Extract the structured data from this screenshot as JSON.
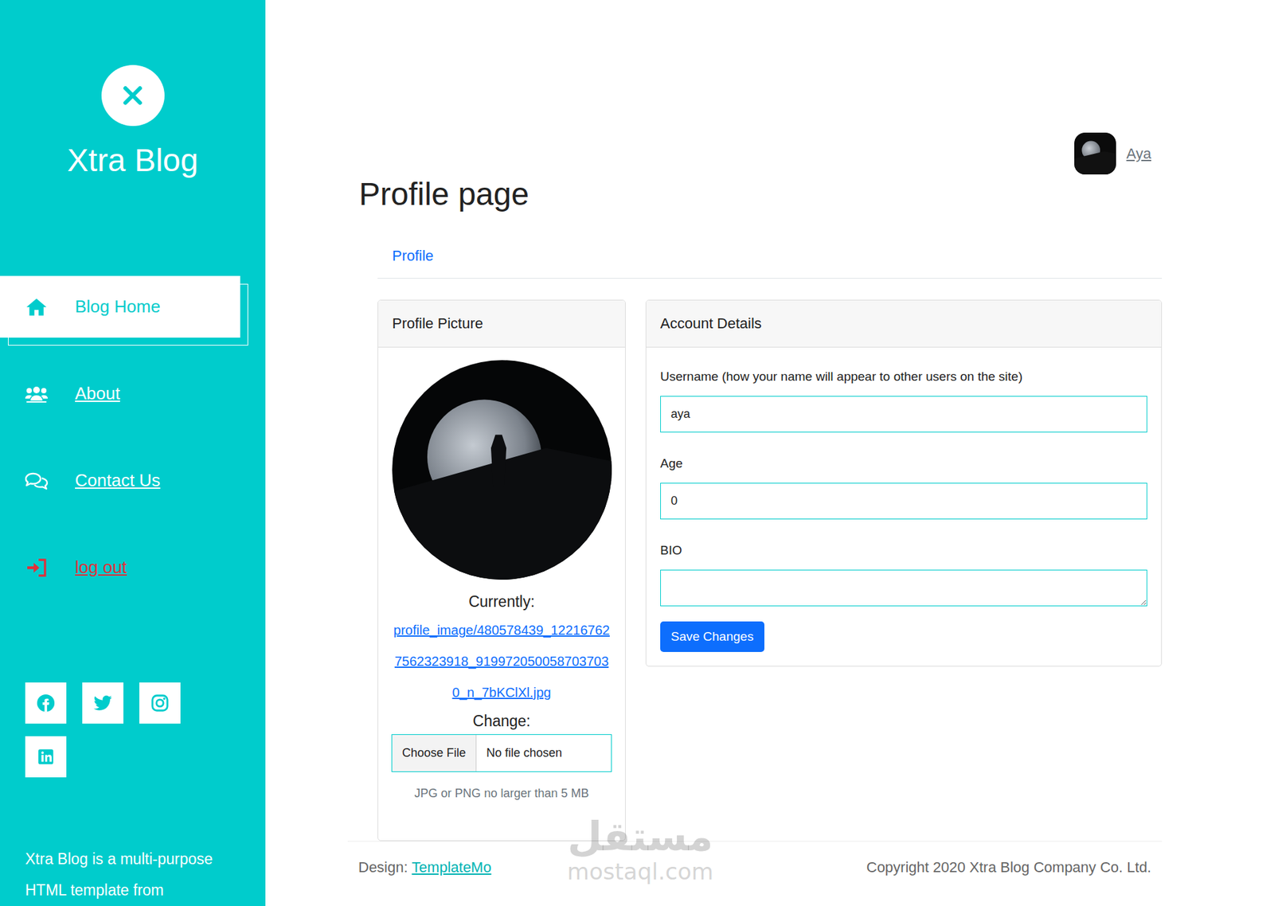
{
  "sidebar": {
    "brand": "Xtra Blog",
    "nav": [
      {
        "label": "Blog Home",
        "selected": true,
        "kind": "link"
      },
      {
        "label": "About",
        "selected": false,
        "kind": "link"
      },
      {
        "label": "Contact Us",
        "selected": false,
        "kind": "link"
      },
      {
        "label": "log out",
        "selected": false,
        "kind": "danger"
      }
    ],
    "about_text": "Xtra Blog is a multi-purpose HTML template from"
  },
  "user": {
    "name": "Aya"
  },
  "page_title": "Profile page",
  "tabs": [
    {
      "label": "Profile",
      "selected": true
    }
  ],
  "picture_card": {
    "title": "Profile Picture",
    "currently_label": "Currently:",
    "file_link": "profile_image/480578439_122167627562323918_9199720500587037030_n_7bKClXl.jpg",
    "change_label": "Change:",
    "file_button": "Choose File",
    "file_status": "No file chosen",
    "hint": "JPG or PNG no larger than 5 MB"
  },
  "account_card": {
    "title": "Account Details",
    "fields": [
      {
        "label": "Username (how your name will appear to other users on the site)",
        "value": "aya",
        "kind": "input"
      },
      {
        "label": "Age",
        "value": "0",
        "kind": "input"
      },
      {
        "label": "BIO",
        "value": "",
        "kind": "textarea"
      }
    ],
    "button": "Save Changes"
  },
  "footer": {
    "design_label": "Design:",
    "design_link": "TemplateMo",
    "copyright": "Copyright 2020 Xtra Blog Company Co. Ltd."
  },
  "watermark": {
    "logo": "مستقل",
    "site": "mostaql.com"
  }
}
